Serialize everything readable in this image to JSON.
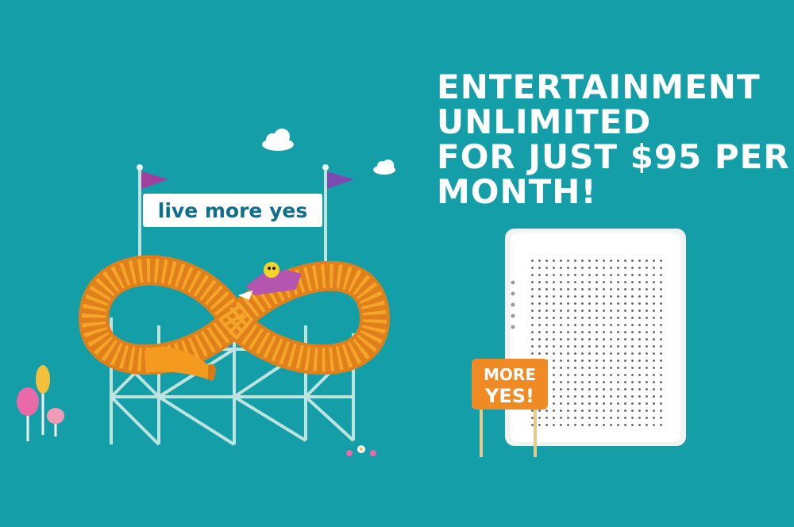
{
  "headline": {
    "line1": "ENTERTAINMENT",
    "line2": "UNLIMITED",
    "line3": "FOR JUST $95 PER",
    "line4": "MONTH!"
  },
  "banner": {
    "text": "live more yes"
  },
  "sign": {
    "line1": "MORE",
    "line2": "YES!"
  },
  "colors": {
    "background": "#149fa8",
    "track_orange": "#f39a1f",
    "flag_purple": "#a13e9e",
    "banner_text": "#0e6f8a",
    "sign_orange": "#f08a24"
  }
}
